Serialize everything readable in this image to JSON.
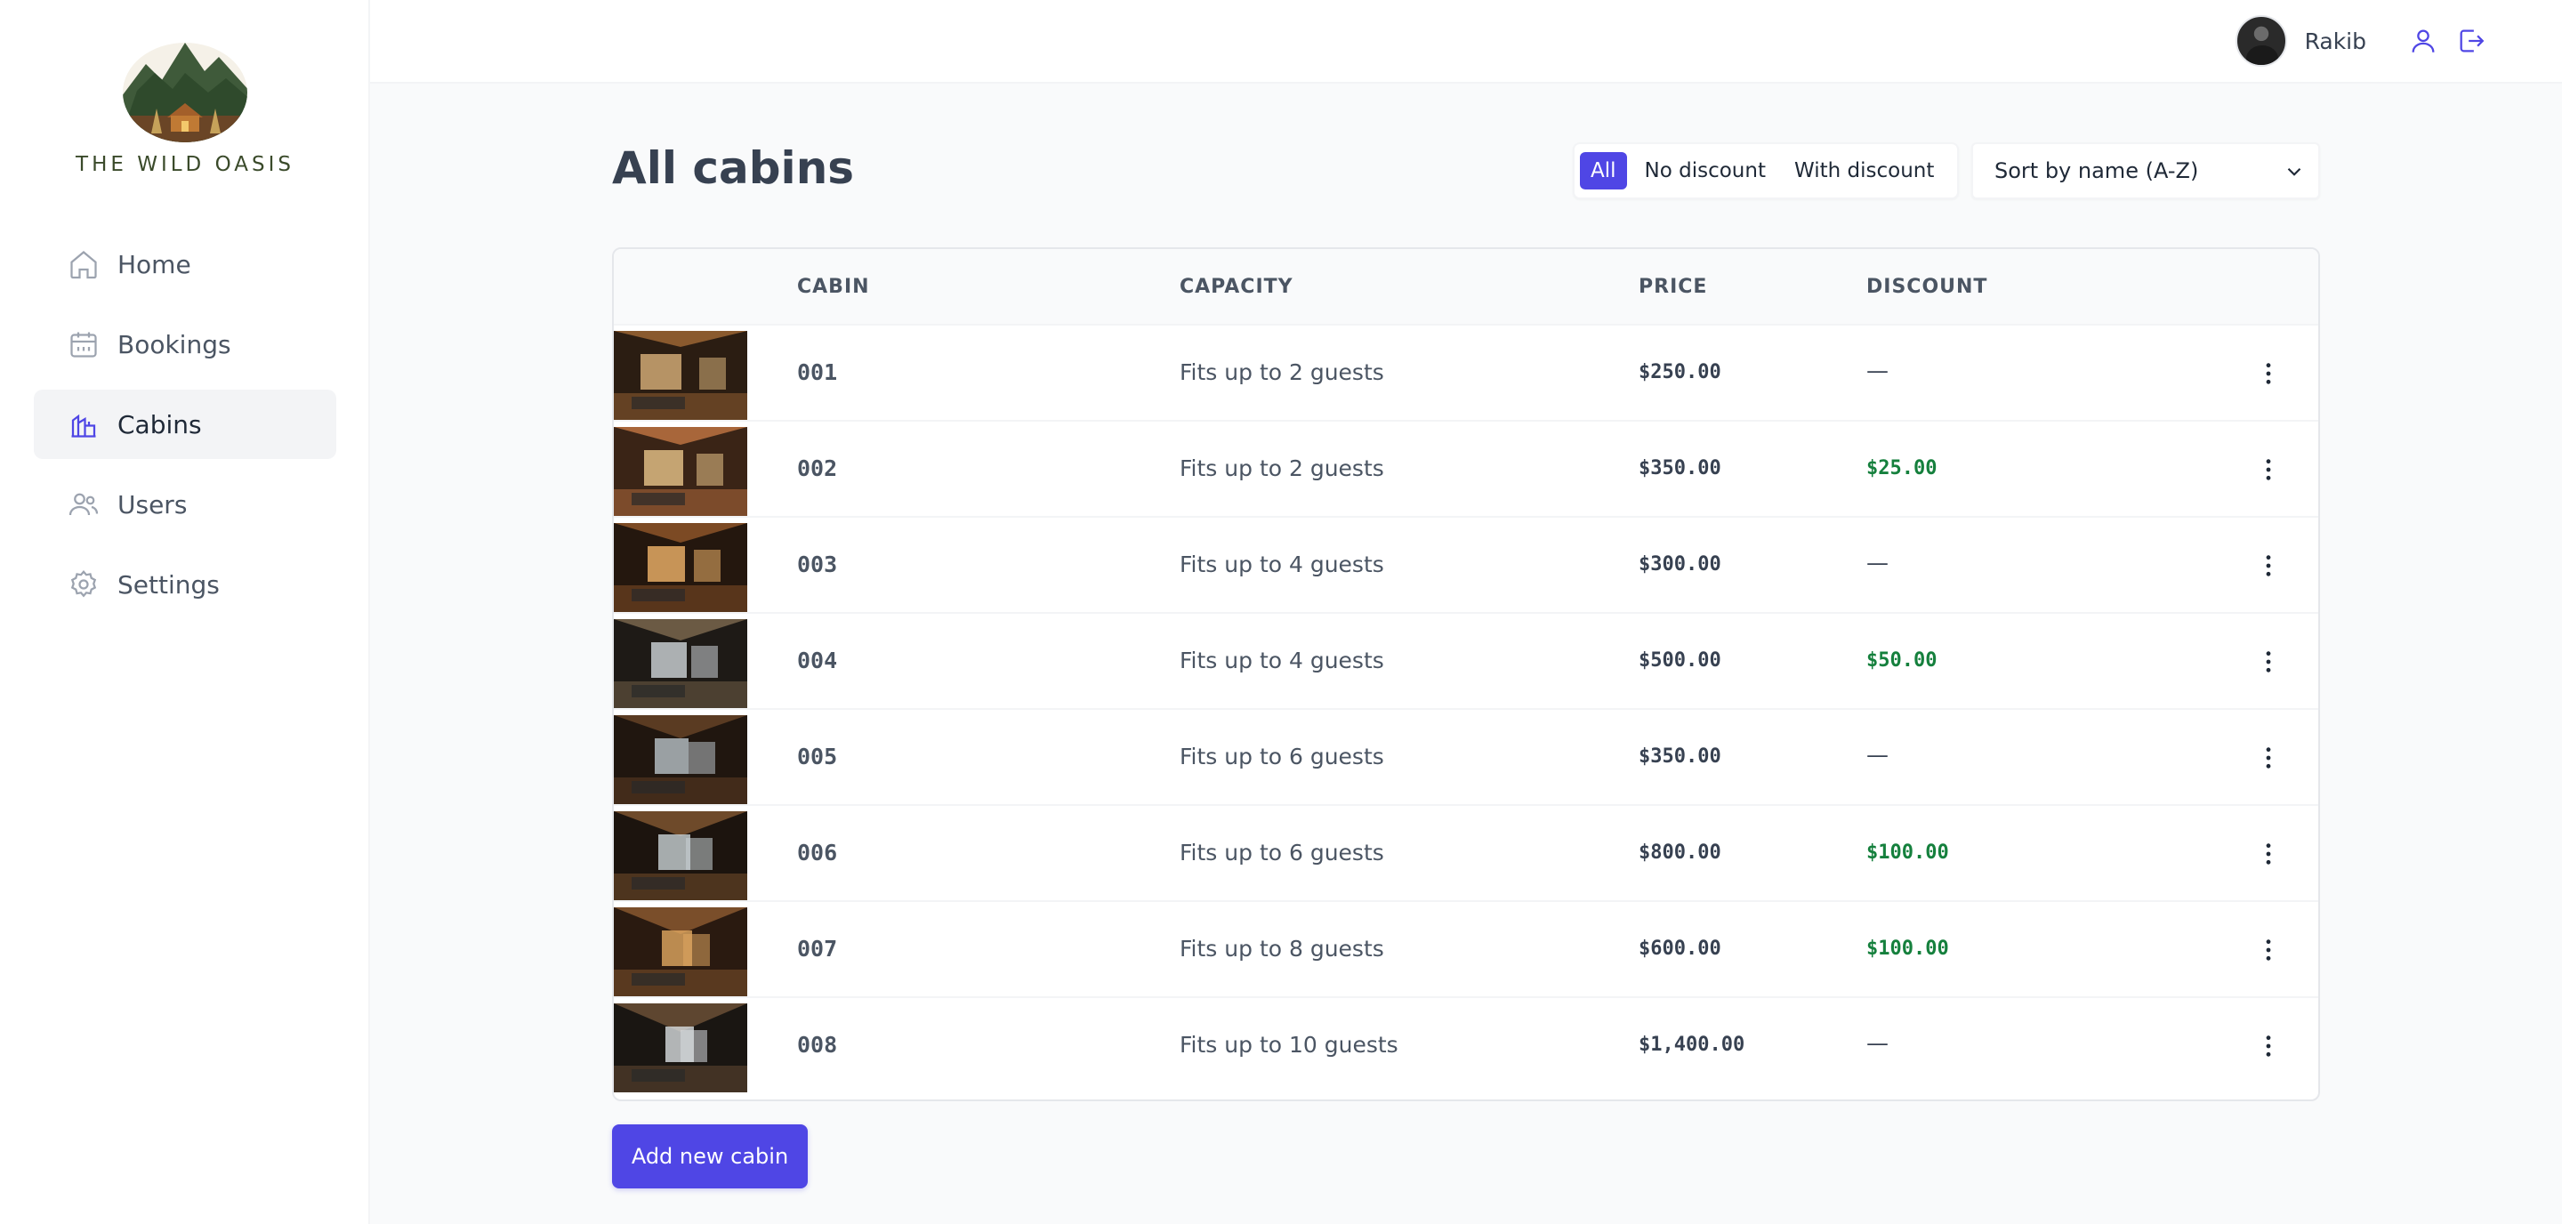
{
  "brand": {
    "name": "THE WILD OASIS",
    "logo_icon": "mountain-cabin-logo"
  },
  "sidebar": {
    "items": [
      {
        "label": "Home",
        "icon": "home-icon",
        "active": false
      },
      {
        "label": "Bookings",
        "icon": "calendar-icon",
        "active": false
      },
      {
        "label": "Cabins",
        "icon": "cabins-icon",
        "active": true
      },
      {
        "label": "Users",
        "icon": "users-icon",
        "active": false
      },
      {
        "label": "Settings",
        "icon": "gear-icon",
        "active": false
      }
    ]
  },
  "header": {
    "user_name": "Rakib",
    "account_icon": "user-icon",
    "logout_icon": "logout-icon"
  },
  "main": {
    "title": "All cabins",
    "filter": {
      "options": [
        "All",
        "No discount",
        "With discount"
      ],
      "selected": "All"
    },
    "sort": {
      "selected": "Sort by name (A-Z)"
    },
    "add_button": "Add new cabin"
  },
  "table": {
    "columns": [
      "",
      "CABIN",
      "CAPACITY",
      "PRICE",
      "DISCOUNT",
      ""
    ],
    "rows": [
      {
        "cabin": "001",
        "capacity": "Fits up to 2 guests",
        "price": "$250.00",
        "discount": "—"
      },
      {
        "cabin": "002",
        "capacity": "Fits up to 2 guests",
        "price": "$350.00",
        "discount": "$25.00"
      },
      {
        "cabin": "003",
        "capacity": "Fits up to 4 guests",
        "price": "$300.00",
        "discount": "—"
      },
      {
        "cabin": "004",
        "capacity": "Fits up to 4 guests",
        "price": "$500.00",
        "discount": "$50.00"
      },
      {
        "cabin": "005",
        "capacity": "Fits up to 6 guests",
        "price": "$350.00",
        "discount": "—"
      },
      {
        "cabin": "006",
        "capacity": "Fits up to 6 guests",
        "price": "$800.00",
        "discount": "$100.00"
      },
      {
        "cabin": "007",
        "capacity": "Fits up to 8 guests",
        "price": "$600.00",
        "discount": "$100.00"
      },
      {
        "cabin": "008",
        "capacity": "Fits up to 10 guests",
        "price": "$1,400.00",
        "discount": "—"
      }
    ]
  },
  "colors": {
    "accent": "#4f46e5",
    "discount_green": "#15803d",
    "background": "#f9fafb"
  }
}
